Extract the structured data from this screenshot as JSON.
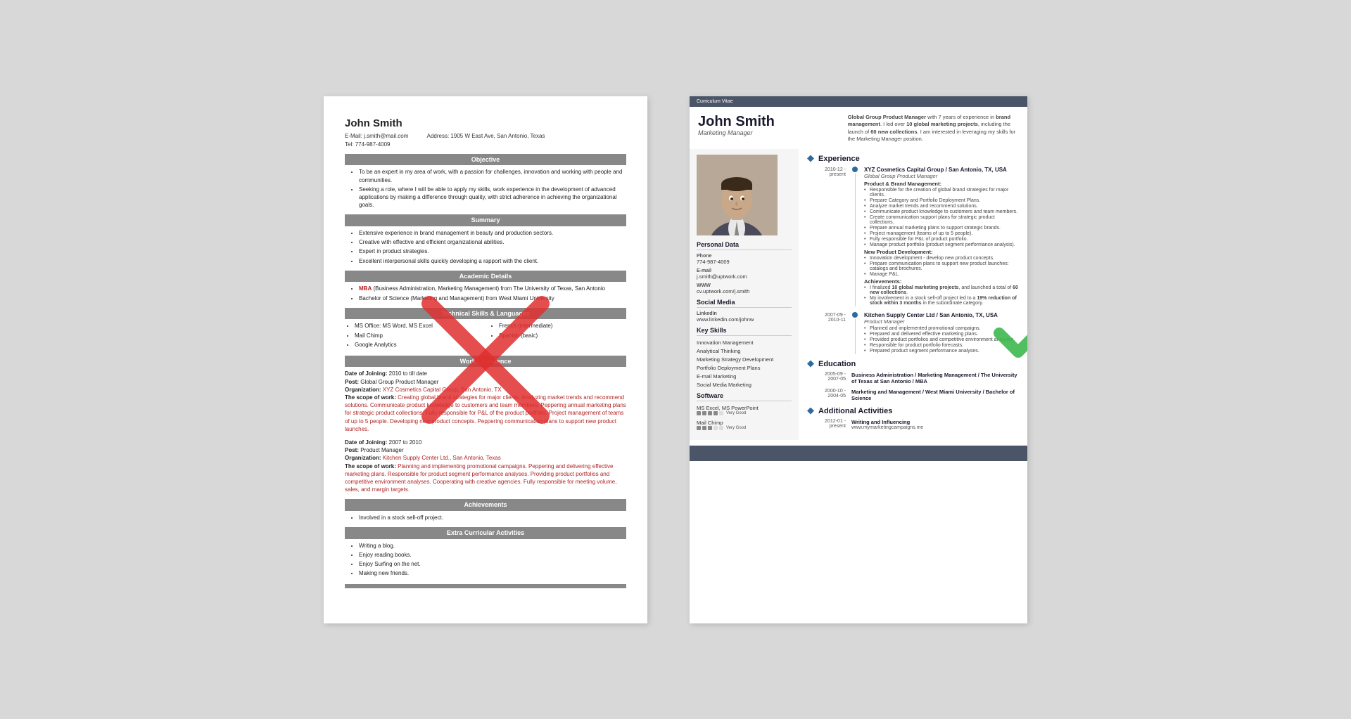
{
  "page": {
    "background": "#d8d8d8"
  },
  "left_resume": {
    "name": "John Smith",
    "email_label": "E-Mail:",
    "email": "j.smith@mail.com",
    "tel_label": "Tel:",
    "tel": "774-987-4009",
    "address_label": "Address:",
    "address": "1905 W East Ave, San Antonio, Texas",
    "sections": {
      "objective": {
        "title": "Objective",
        "bullets": [
          "To be an expert in my area of work, with a passion for challenges, innovation and working with people and communities.",
          "Seeking a role, where I will be able to apply my skills, work experience in the development of advanced applications by making a difference through quality, with strict adherence in achieving the organizational goals."
        ]
      },
      "summary": {
        "title": "Summary",
        "bullets": [
          "Extensive experience in brand management in beauty and production sectors.",
          "Creative with effective and efficient organizational abilities.",
          "Expert in product strategies.",
          "Excellent interpersonal skills quickly developing a rapport with the client."
        ]
      },
      "academic": {
        "title": "Academic Details",
        "items": [
          "MBA (Business Administration, Marketing Management) from The University of Texas, San Antonio",
          "Bachelor of Science (Marketing and Management) from West Miami University"
        ]
      },
      "technical": {
        "title": "Technical Skills & Languages",
        "left": [
          "MS Office: MS Word, MS Excel",
          "Mail Chimp",
          "Google Analytics"
        ],
        "right": [
          "French (intermediate)",
          "Spanish (basic)"
        ]
      },
      "work": {
        "title": "Work Experience",
        "entries": [
          {
            "date_label": "Date of Joining:",
            "date": "2010 to till date",
            "post_label": "Post:",
            "post": "Global Group Product Manager",
            "org_label": "Organization:",
            "org": "XYZ Cosmetics Capital Group, San Antonio, TX",
            "scope_label": "The scope of work:",
            "scope": "Creating global brand strategies for major clients. Analyzing market trends and recommend solutions. Communicate product knowledge to customers and team members. Peppering annual marketing plans for strategic product collections. Fully responsible for P&L of the product portfolio. Project management of teams of up to 5 people. Developing new product concepts. Peppering communication plans to support new product launches."
          },
          {
            "date_label": "Date of Joining:",
            "date": "2007 to 2010",
            "post_label": "Post:",
            "post": "Product Manager",
            "org_label": "Organization:",
            "org": "Kitchen Supply Center Ltd., San Antonio, Texas",
            "scope_label": "The scope of work:",
            "scope": "Planning and implementing promotional campaigns. Peppering and delivering effective marketing plans. Responsible for product segment performance analyses. Providing product portfolios and competitive environment analyses. Cooperating with creative agencies. Fully responsible for meeting volume, sales, and margin targets."
          }
        ]
      },
      "achievements": {
        "title": "Achievements",
        "items": [
          "Involved in a stock sell-off project."
        ]
      },
      "extra": {
        "title": "Extra Curricular Activities",
        "items": [
          "Writing a blog.",
          "Enjoy reading books.",
          "Enjoy Surfing on the net.",
          "Making new friends."
        ]
      }
    }
  },
  "right_resume": {
    "cv_label": "Curriculum Vitae",
    "name": "John Smith",
    "title": "Marketing Manager",
    "summary": "Global Group Product Manager with 7 years of experience in brand management. I led over 10 global marketing projects, including the launch of 60 new collections. I am interested in leveraging my skills for the Marketing Manager position.",
    "photo_alt": "professional headshot",
    "personal_data": {
      "title": "Personal Data",
      "phone_label": "Phone",
      "phone": "774-987-4009",
      "email_label": "E-mail",
      "email": "j.smith@uptwork.com",
      "www_label": "WWW",
      "www": "cv.uptwork.com/j.smith",
      "social_label": "Social Media",
      "linkedin_label": "LinkedIn",
      "linkedin": "www.linkedin.com/johnw"
    },
    "skills": {
      "title": "Key Skills",
      "items": [
        "Innovation Management",
        "Analytical Thinking",
        "Marketing Strategy Development",
        "Portfolio Deployment Plans",
        "E-mail Marketing",
        "Social Media Marketing"
      ]
    },
    "software": {
      "title": "Software",
      "items": [
        {
          "name": "MS Excel, MS PowerPoint",
          "level": 4,
          "max": 5,
          "label": "Very Good"
        },
        {
          "name": "Mail Chimp",
          "level": 3,
          "max": 5,
          "label": "Very Good"
        }
      ]
    },
    "experience": {
      "title": "Experience",
      "entries": [
        {
          "start": "2010-12",
          "end": "present",
          "company": "XYZ Cosmetics Capital Group / San Antonio, TX, USA",
          "role": "Global Group Product Manager",
          "subsections": [
            {
              "title": "Product & Brand Management:",
              "bullets": [
                "Responsible for the creation of global brand strategies for major clients.",
                "Prepare Category and Portfolio Deployment Plans.",
                "Analyze market trends and recommend solutions.",
                "Communicate product knowledge to customers and team members.",
                "Create communication support plans for strategic product collections.",
                "Prepare annual marketing plans to support strategic brands.",
                "Project management (teams of up to 5 people).",
                "Fully responsible for P&L of product portfolio.",
                "Manage product portfolio (product segment performance analysis)."
              ]
            },
            {
              "title": "New Product Development:",
              "bullets": [
                "Innovation development - develop new product concepts.",
                "Prepare communication plans to support new product launches: catalogs and brochures.",
                "Manage P&L."
              ]
            },
            {
              "title": "Achievements:",
              "bullets": [
                "I finalized 10 global marketing projects, and launched a total of 60 new collections.",
                "My involvement in a stock sell-off project led to a 19% reduction of stock within 3 months in the subordinate category."
              ]
            }
          ]
        },
        {
          "start": "2007-09",
          "end": "2010-11",
          "company": "Kitchen Supply Center Ltd / San Antonio, TX, USA",
          "role": "Product Manager",
          "subsections": [
            {
              "title": "",
              "bullets": [
                "Planned and implemented promotional campaigns.",
                "Prepared and delivered effective marketing plans.",
                "Provided product portfolios and competitive environment analyses.",
                "Responsible for product portfolio forecasts.",
                "Prepared product segment performance analyses."
              ]
            }
          ]
        }
      ]
    },
    "education": {
      "title": "Education",
      "entries": [
        {
          "start": "2005-09",
          "end": "2007-05",
          "degree": "Business Administration / Marketing Management / The University of Texas at San Antonio / MBA"
        },
        {
          "start": "2000-10",
          "end": "2004-05",
          "degree": "Marketing and Management / West Miami University / Bachelor of Science"
        }
      ]
    },
    "activities": {
      "title": "Additional Activities",
      "entries": [
        {
          "start": "2012-01",
          "end": "present",
          "title": "Writing and Influencing",
          "detail": "www.mymarketingcampaigns.me"
        }
      ]
    }
  }
}
